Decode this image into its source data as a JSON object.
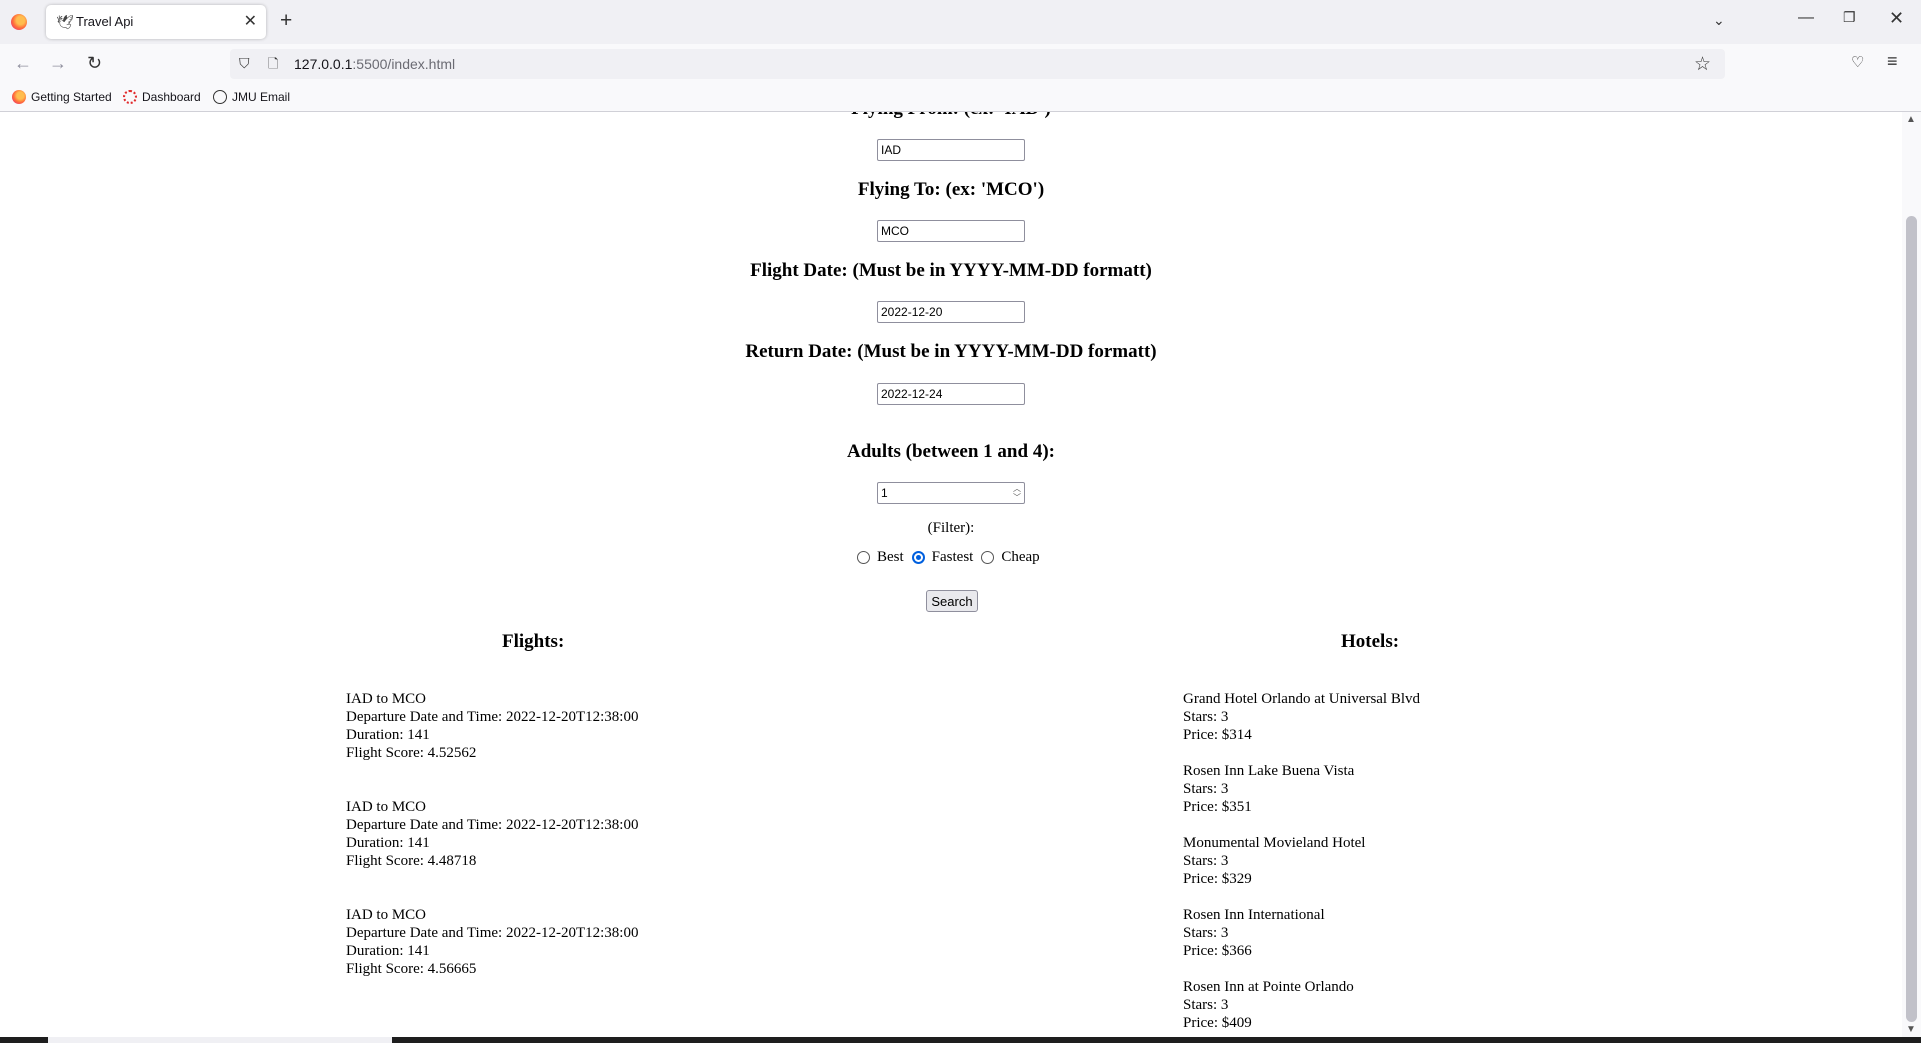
{
  "browser": {
    "tab_title": "Travel Api",
    "url_host": "127.0.0.1",
    "url_path": ":5500/index.html",
    "bookmarks": [
      "Getting Started",
      "Dashboard",
      "JMU Email"
    ]
  },
  "form": {
    "from_label": "Flying From: (ex: 'IAD')",
    "from_value": "IAD",
    "to_label": "Flying To: (ex: 'MCO')",
    "to_value": "MCO",
    "date_label": "Flight Date: (Must be in YYYY-MM-DD formatt)",
    "date_value": "2022-12-20",
    "return_label": "Return Date: (Must be in YYYY-MM-DD formatt)",
    "return_value": "2022-12-24",
    "adults_label": "Adults (between 1 and 4):",
    "adults_value": "1",
    "filter_label": "(Filter):",
    "filter_options": [
      "Best",
      "Fastest",
      "Cheap"
    ],
    "filter_selected": "Fastest",
    "search_label": "Search"
  },
  "flights": {
    "heading": "Flights:",
    "items": [
      {
        "route": "IAD to MCO",
        "departure": "Departure Date and Time: 2022-12-20T12:38:00",
        "duration": "Duration: 141",
        "score": "Flight Score: 4.52562"
      },
      {
        "route": "IAD to MCO",
        "departure": "Departure Date and Time: 2022-12-20T12:38:00",
        "duration": "Duration: 141",
        "score": "Flight Score: 4.48718"
      },
      {
        "route": "IAD to MCO",
        "departure": "Departure Date and Time: 2022-12-20T12:38:00",
        "duration": "Duration: 141",
        "score": "Flight Score: 4.56665"
      }
    ]
  },
  "hotels": {
    "heading": "Hotels:",
    "items": [
      {
        "name": "Grand Hotel Orlando at Universal Blvd",
        "stars": "Stars: 3",
        "price": "Price: $314"
      },
      {
        "name": "Rosen Inn Lake Buena Vista",
        "stars": "Stars: 3",
        "price": "Price: $351"
      },
      {
        "name": "Monumental Movieland Hotel",
        "stars": "Stars: 3",
        "price": "Price: $329"
      },
      {
        "name": "Rosen Inn International",
        "stars": "Stars: 3",
        "price": "Price: $366"
      },
      {
        "name": "Rosen Inn at Pointe Orlando",
        "stars": "Stars: 3",
        "price": "Price: $409"
      }
    ]
  },
  "colors": {
    "accent": "#0060df",
    "chrome_bg": "#f0f0f4"
  }
}
